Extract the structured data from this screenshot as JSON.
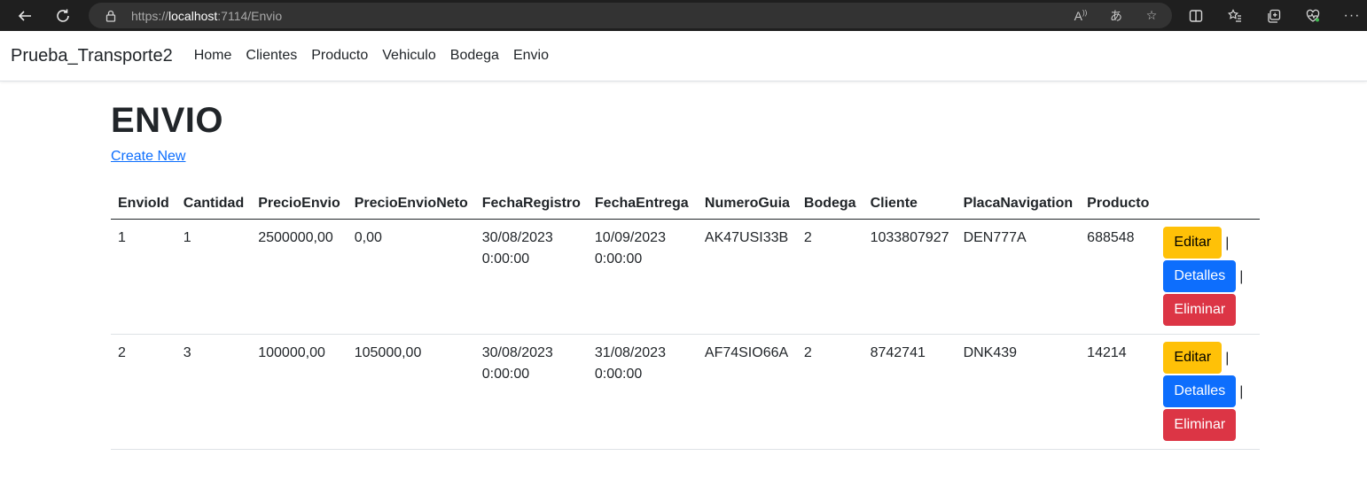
{
  "browser": {
    "url_scheme": "https://",
    "url_host": "localhost",
    "url_rest": ":7114/Envio"
  },
  "navbar": {
    "brand": "Prueba_Transporte2",
    "links": [
      "Home",
      "Clientes",
      "Producto",
      "Vehiculo",
      "Bodega",
      "Envio"
    ]
  },
  "page": {
    "title": "ENVIO",
    "create_link": "Create New"
  },
  "table": {
    "headers": [
      "EnvioId",
      "Cantidad",
      "PrecioEnvio",
      "PrecioEnvioNeto",
      "FechaRegistro",
      "FechaEntrega",
      "NumeroGuia",
      "Bodega",
      "Cliente",
      "PlacaNavigation",
      "Producto"
    ],
    "rows": [
      {
        "envioId": "1",
        "cantidad": "1",
        "precioEnvio": "2500000,00",
        "precioEnvioNeto": "0,00",
        "fechaRegistro": "30/08/2023 0:00:00",
        "fechaEntrega": "10/09/2023 0:00:00",
        "numeroGuia": "AK47USI33B",
        "bodega": "2",
        "cliente": "1033807927",
        "placa": "DEN777A",
        "producto": "688548"
      },
      {
        "envioId": "2",
        "cantidad": "3",
        "precioEnvio": "100000,00",
        "precioEnvioNeto": "105000,00",
        "fechaRegistro": "30/08/2023 0:00:00",
        "fechaEntrega": "31/08/2023 0:00:00",
        "numeroGuia": "AF74SIO66A",
        "bodega": "2",
        "cliente": "8742741",
        "placa": "DNK439",
        "producto": "14214"
      }
    ],
    "actions": {
      "edit": "Editar",
      "details": "Detalles",
      "delete": "Eliminar",
      "separator": "|"
    }
  },
  "colors": {
    "edit": "#ffc107",
    "details": "#0d6efd",
    "delete": "#dc3545",
    "link": "#0d6efd"
  }
}
